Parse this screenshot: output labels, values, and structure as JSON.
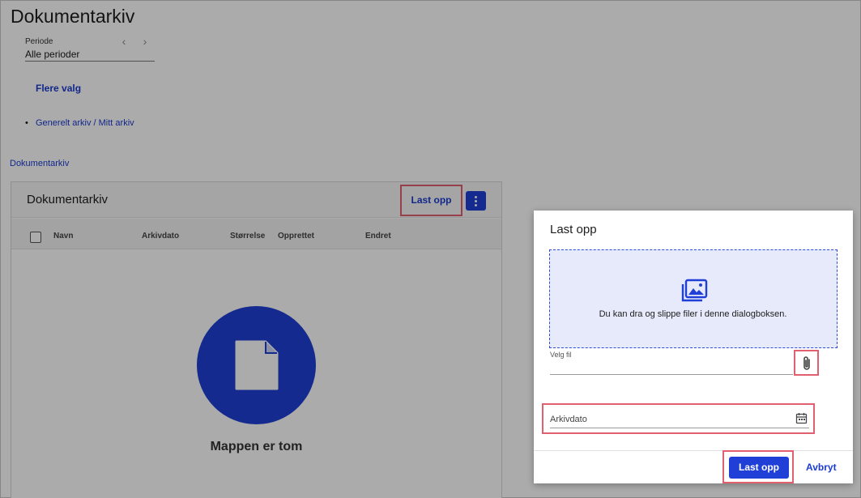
{
  "page": {
    "title": "Dokumentarkiv",
    "periode_label": "Periode",
    "periode_value": "Alle perioder",
    "flere_valg": "Flere valg",
    "breadcrumb": "Generelt arkiv / Mitt arkiv",
    "doc_link": "Dokumentarkiv"
  },
  "card": {
    "title": "Dokumentarkiv",
    "upload_label": "Last opp",
    "columns": [
      "Navn",
      "Arkivdato",
      "Størrelse",
      "Opprettet",
      "Endret"
    ],
    "empty_text": "Mappen er tom"
  },
  "dialog": {
    "title": "Last opp",
    "dropzone_text": "Du kan dra og slippe filer i denne dialogboksen.",
    "file_label": "Velg fil",
    "date_label": "Arkivdato",
    "submit_label": "Last opp",
    "cancel_label": "Avbryt"
  },
  "colors": {
    "accent": "#1f3fd6",
    "link": "#1a3bd0",
    "highlight": "#e06070",
    "dropzone_bg": "#e7eafb"
  }
}
